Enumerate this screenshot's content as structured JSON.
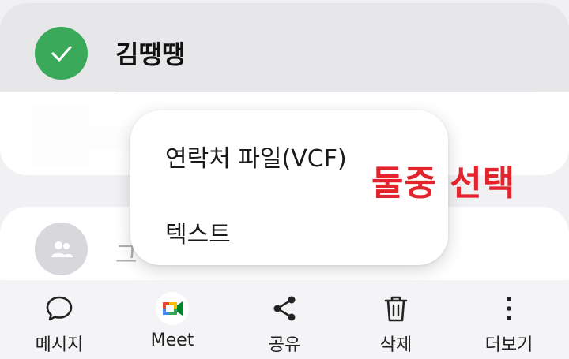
{
  "contact": {
    "name": "김땡땡",
    "selected": true
  },
  "group_item": {
    "partial_text": "그"
  },
  "share_menu": {
    "items": [
      {
        "label": "연락처 파일(VCF)"
      },
      {
        "label": "텍스트"
      }
    ]
  },
  "annotation": {
    "text": "둘중 선택",
    "color": "#e4242c"
  },
  "bottom_bar": {
    "message_label": "메시지",
    "meet_label": "Meet",
    "share_label": "공유",
    "delete_label": "삭제",
    "more_label": "더보기"
  },
  "colors": {
    "selected_check": "#3aaa5a",
    "background": "#f1f1f3"
  },
  "icons": {
    "check": "check-icon",
    "group": "group-icon",
    "message": "chat-bubble-icon",
    "meet": "google-meet-icon",
    "share": "share-icon",
    "delete": "trash-icon",
    "more": "more-vertical-icon"
  }
}
